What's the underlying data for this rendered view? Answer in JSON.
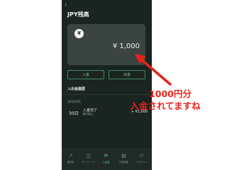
{
  "screen": {
    "title": "JPY残高",
    "balance": {
      "currency_symbol": "¥",
      "amount": "¥ 1,000"
    },
    "buttons": {
      "deposit": "入金",
      "withdraw": "出金"
    },
    "history": {
      "section_title": "入出金履歴",
      "month": "2022/05",
      "items": [
        {
          "day": "30日",
          "title": "入金完了",
          "subtitle": "銀行振込",
          "amount": "+ ¥1,000"
        }
      ]
    },
    "tabbar": {
      "tabs": [
        {
          "label": "販売所",
          "icon": "chart-icon",
          "glyph": "↗"
        },
        {
          "label": "マイトレード",
          "icon": "wallet-icon",
          "glyph": "◫"
        },
        {
          "label": "入出金",
          "icon": "transfer-icon",
          "glyph": "⟳"
        },
        {
          "label": "口座管理",
          "icon": "document-icon",
          "glyph": "▤"
        },
        {
          "label": "アカウント",
          "icon": "user-icon",
          "glyph": "⚇"
        }
      ],
      "active_index": 2
    }
  },
  "annotation": {
    "line1": "1000円分",
    "line2": "入金されてますね",
    "color": "#e8221a"
  },
  "colors": {
    "app_background": "#1a2420",
    "card": "#3a4440",
    "accent_green": "#6fd39a"
  }
}
